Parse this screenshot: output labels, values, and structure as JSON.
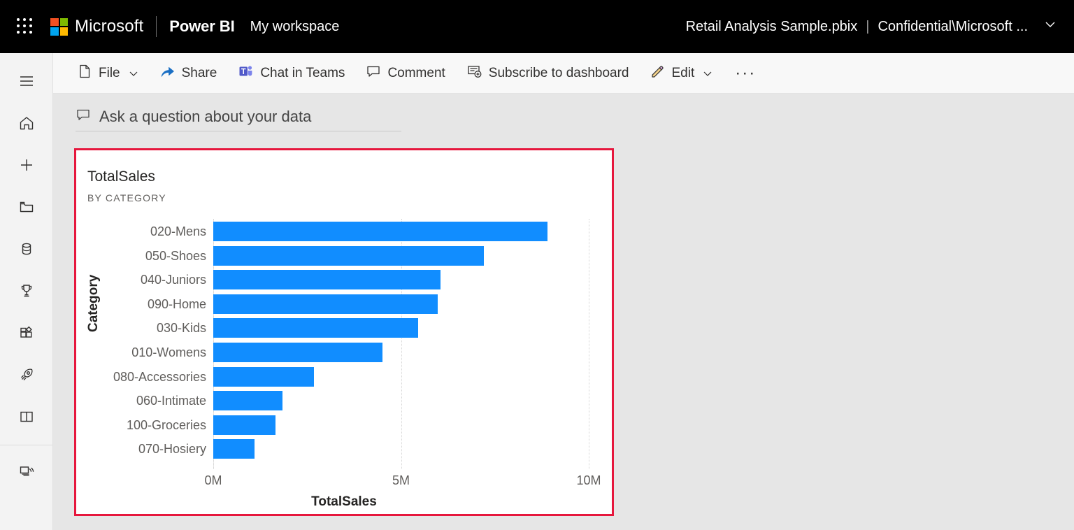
{
  "header": {
    "waffle_label": "app-launcher",
    "brand": "Microsoft",
    "product": "Power BI",
    "workspace": "My workspace",
    "file_name": "Retail Analysis Sample.pbix",
    "separator": "|",
    "sensitivity": "Confidential\\Microsoft ...",
    "chevron": "⌄",
    "logo_colors": {
      "top_left": "#F25022",
      "top_right": "#7FBA00",
      "bottom_left": "#00A4EF",
      "bottom_right": "#FFB900"
    }
  },
  "rail": {
    "items": [
      {
        "name": "navigation-toggle",
        "icon": "hamburger-icon",
        "label": "Navigation"
      },
      {
        "name": "home",
        "icon": "home-icon",
        "label": "Home"
      },
      {
        "name": "create",
        "icon": "plus-icon",
        "label": "Create"
      },
      {
        "name": "browse",
        "icon": "folder-icon",
        "label": "Browse"
      },
      {
        "name": "data-hub",
        "icon": "database-icon",
        "label": "Data hub"
      },
      {
        "name": "metrics",
        "icon": "trophy-icon",
        "label": "Metrics"
      },
      {
        "name": "apps",
        "icon": "apps-grid-icon",
        "label": "Apps"
      },
      {
        "name": "deployment-pipelines",
        "icon": "rocket-icon",
        "label": "Deployment pipelines"
      },
      {
        "name": "learn",
        "icon": "book-icon",
        "label": "Learn"
      },
      {
        "name": "workspaces",
        "icon": "workspaces-icon",
        "label": "Workspaces"
      }
    ]
  },
  "commandbar": {
    "items": [
      {
        "name": "file-menu",
        "label": "File",
        "icon": "file-icon",
        "has_chevron": true
      },
      {
        "name": "share-button",
        "label": "Share",
        "icon": "share-icon",
        "has_chevron": false
      },
      {
        "name": "chat-in-teams-button",
        "label": "Chat in Teams",
        "icon": "teams-icon",
        "has_chevron": false
      },
      {
        "name": "comment-button",
        "label": "Comment",
        "icon": "comment-icon",
        "has_chevron": false
      },
      {
        "name": "subscribe-button",
        "label": "Subscribe to dashboard",
        "icon": "subscribe-icon",
        "has_chevron": false
      },
      {
        "name": "edit-button",
        "label": "Edit",
        "icon": "pencil-icon",
        "has_chevron": true
      }
    ],
    "overflow_label": "···"
  },
  "qna": {
    "placeholder": "Ask a question about your data",
    "icon": "qna-bubble-icon"
  },
  "visual": {
    "title": "TotalSales",
    "subtitle": "BY CATEGORY",
    "selection_border_color": "#e6173d",
    "bar_color": "#118dff"
  },
  "chart_data": {
    "type": "bar",
    "orientation": "horizontal",
    "title": "TotalSales",
    "subtitle": "BY CATEGORY",
    "xlabel": "TotalSales",
    "ylabel": "Category",
    "xlim": [
      0,
      10000000
    ],
    "xticks": [
      0,
      5000000,
      10000000
    ],
    "xtick_labels": [
      "0M",
      "5M",
      "10M"
    ],
    "grid": true,
    "legend": false,
    "categories": [
      "020-Mens",
      "050-Shoes",
      "040-Juniors",
      "090-Home",
      "030-Kids",
      "010-Womens",
      "080-Accessories",
      "060-Intimate",
      "100-Groceries",
      "070-Hosiery"
    ],
    "values": [
      8900000,
      7200000,
      6050000,
      5980000,
      5450000,
      4500000,
      2680000,
      1840000,
      1650000,
      1100000
    ],
    "series": [
      {
        "name": "TotalSales",
        "color": "#118dff",
        "values": [
          8900000,
          7200000,
          6050000,
          5980000,
          5450000,
          4500000,
          2680000,
          1840000,
          1650000,
          1100000
        ]
      }
    ]
  }
}
